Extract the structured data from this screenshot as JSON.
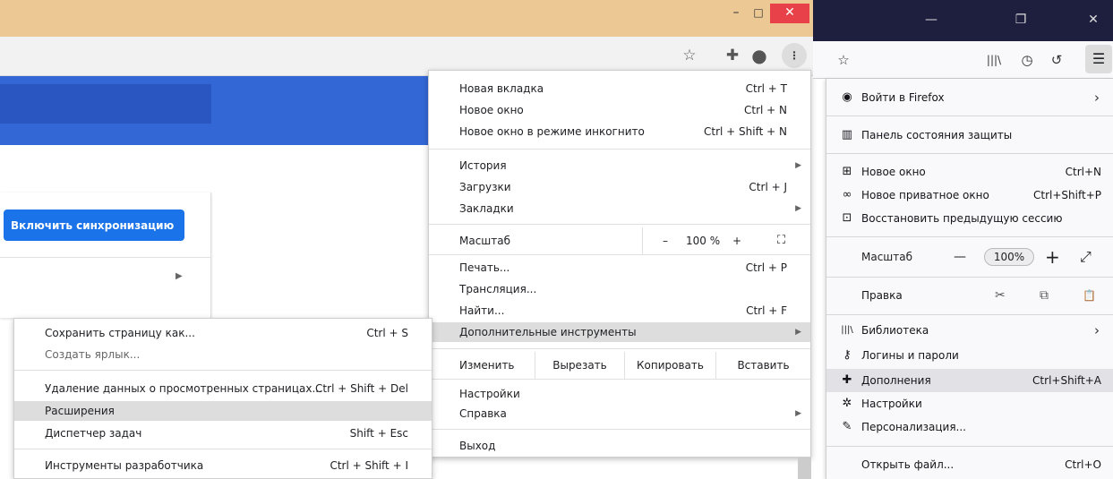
{
  "chrome": {
    "window": {
      "minimize": "–",
      "maximize": "□",
      "close": "✕"
    },
    "toolbar": {
      "star_icon": "☆",
      "ext_icon": "✚",
      "profile_icon": "●",
      "menu_icon": "⋮"
    },
    "page": {
      "sync_button": "Включить синхронизацию",
      "row_arrow": "▶"
    },
    "menu": {
      "new_tab": {
        "label": "Новая вкладка",
        "shortcut": "Ctrl + T"
      },
      "new_window": {
        "label": "Новое окно",
        "shortcut": "Ctrl + N"
      },
      "incognito": {
        "label": "Новое окно в режиме инкогнито",
        "shortcut": "Ctrl + Shift + N"
      },
      "history": {
        "label": "История"
      },
      "downloads": {
        "label": "Загрузки",
        "shortcut": "Ctrl + J"
      },
      "bookmarks": {
        "label": "Закладки"
      },
      "zoom": {
        "label": "Масштаб",
        "minus": "–",
        "value": "100 %",
        "plus": "+",
        "fullscreen": "⛶"
      },
      "print": {
        "label": "Печать...",
        "shortcut": "Ctrl + P"
      },
      "cast": {
        "label": "Трансляция..."
      },
      "find": {
        "label": "Найти...",
        "shortcut": "Ctrl + F"
      },
      "more_tools": {
        "label": "Дополнительные инструменты"
      },
      "edit": {
        "label": "Изменить",
        "cut": "Вырезать",
        "copy": "Копировать",
        "paste": "Вставить"
      },
      "settings": {
        "label": "Настройки"
      },
      "help": {
        "label": "Справка"
      },
      "exit": {
        "label": "Выход"
      },
      "arrow": "▶"
    },
    "submenu": {
      "save_page": {
        "label": "Сохранить страницу как...",
        "shortcut": "Ctrl + S"
      },
      "create_shortcut": {
        "label": "Создать ярлык..."
      },
      "clear_data": {
        "label": "Удаление данных о просмотренных страницах...",
        "shortcut": "Ctrl + Shift + Del"
      },
      "extensions": {
        "label": "Расширения"
      },
      "task_manager": {
        "label": "Диспетчер задач",
        "shortcut": "Shift + Esc"
      },
      "dev_tools": {
        "label": "Инструменты разработчика",
        "shortcut": "Ctrl + Shift + I"
      }
    }
  },
  "firefox": {
    "window": {
      "minimize": "—",
      "maximize": "❐",
      "close": "✕"
    },
    "toolbar": {
      "star_icon": "☆",
      "library_icon": "|||\\",
      "history_icon": "◷",
      "back_icon": "↺",
      "menu_icon": "☰"
    },
    "menu": {
      "sign_in": {
        "label": "Войти в Firefox",
        "icon": "◉",
        "arrow": "›"
      },
      "protection": {
        "label": "Панель состояния защиты",
        "icon": "▥"
      },
      "new_window": {
        "label": "Новое окно",
        "shortcut": "Ctrl+N",
        "icon": "⊞"
      },
      "private_window": {
        "label": "Новое приватное окно",
        "shortcut": "Ctrl+Shift+P",
        "icon": "∞"
      },
      "restore_session": {
        "label": "Восстановить предыдущую сессию",
        "icon": "⊡"
      },
      "zoom": {
        "label": "Масштаб",
        "minus": "—",
        "value": "100%",
        "plus": "+",
        "fullscreen": "⤢"
      },
      "edit": {
        "label": "Правка",
        "cut_icon": "✂",
        "copy_icon": "⧉",
        "paste_icon": "📋"
      },
      "library": {
        "label": "Библиотека",
        "icon": "|||\\",
        "arrow": "›"
      },
      "logins": {
        "label": "Логины и пароли",
        "icon": "⚷"
      },
      "addons": {
        "label": "Дополнения",
        "shortcut": "Ctrl+Shift+A",
        "icon": "✚"
      },
      "settings": {
        "label": "Настройки",
        "icon": "✲"
      },
      "customize": {
        "label": "Персонализация...",
        "icon": "✎"
      },
      "open_file": {
        "label": "Открыть файл...",
        "shortcut": "Ctrl+O"
      }
    }
  }
}
